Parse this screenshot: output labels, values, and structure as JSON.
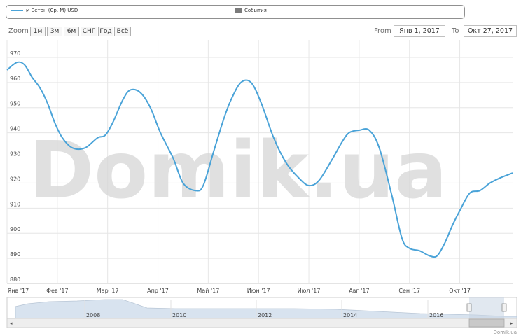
{
  "legend": {
    "series_label": "м Бетон (Ср. М) USD",
    "events_label": "События"
  },
  "zoom": {
    "label": "Zoom",
    "buttons": [
      "1м",
      "3м",
      "6м",
      "СНГ",
      "Год",
      "Всё"
    ]
  },
  "range": {
    "from_label": "From",
    "from_value": "Янв 1, 2017",
    "to_label": "To",
    "to_value": "Окт 27, 2017"
  },
  "watermark": "Domik.ua",
  "credit": "Domik.ua",
  "colors": {
    "line": "#4aa3d8",
    "grid": "#e6e6e6",
    "navigator_fill": "#d8e3ef",
    "navigator_mask": "#c9d6e3"
  },
  "chart_data": {
    "type": "line",
    "title": "",
    "xlabel": "",
    "ylabel": "",
    "ylim": [
      880,
      975
    ],
    "yticks": [
      880,
      890,
      900,
      910,
      920,
      930,
      940,
      950,
      960,
      970
    ],
    "xlim": [
      0,
      10.05
    ],
    "xticks": [
      {
        "label": "Янв '17",
        "x": 0
      },
      {
        "label": "Фев '17",
        "x": 1
      },
      {
        "label": "Мар '17",
        "x": 2
      },
      {
        "label": "Апр '17",
        "x": 3
      },
      {
        "label": "Май '17",
        "x": 4
      },
      {
        "label": "Июн '17",
        "x": 5
      },
      {
        "label": "Июл '17",
        "x": 6
      },
      {
        "label": "Авг '17",
        "x": 7
      },
      {
        "label": "Сен '17",
        "x": 8
      },
      {
        "label": "Окт '17",
        "x": 9
      }
    ],
    "series": [
      {
        "name": "м Бетон (Ср. М) USD",
        "x": [
          0,
          0.2,
          0.35,
          0.5,
          0.65,
          0.8,
          0.95,
          1.1,
          1.3,
          1.55,
          1.8,
          1.95,
          2.1,
          2.3,
          2.45,
          2.65,
          2.85,
          3.05,
          3.3,
          3.5,
          3.75,
          3.9,
          4.1,
          4.3,
          4.45,
          4.65,
          4.85,
          5.05,
          5.3,
          5.55,
          5.8,
          6.0,
          6.2,
          6.45,
          6.65,
          6.8,
          7.0,
          7.2,
          7.4,
          7.65,
          7.85,
          8.0,
          8.2,
          8.4,
          8.55,
          8.7,
          8.85,
          9.0,
          9.2,
          9.4,
          9.6,
          9.8,
          10.05
        ],
        "y": [
          965,
          968,
          967,
          962,
          958,
          952,
          944,
          938,
          934,
          934,
          938,
          939,
          944,
          953,
          957,
          956,
          950,
          940,
          930,
          920,
          917,
          919,
          932,
          945,
          953,
          960,
          960,
          952,
          938,
          928,
          922,
          919,
          921,
          929,
          936,
          940,
          941,
          941,
          934,
          915,
          898,
          894,
          893,
          891,
          891,
          896,
          903,
          909,
          916,
          917,
          920,
          922,
          924
        ]
      }
    ],
    "navigator": {
      "labels": [
        "2008",
        "2010",
        "2012",
        "2014",
        "2016"
      ],
      "selection": "Янв 1, 2017 – Окт 27, 2017"
    }
  }
}
